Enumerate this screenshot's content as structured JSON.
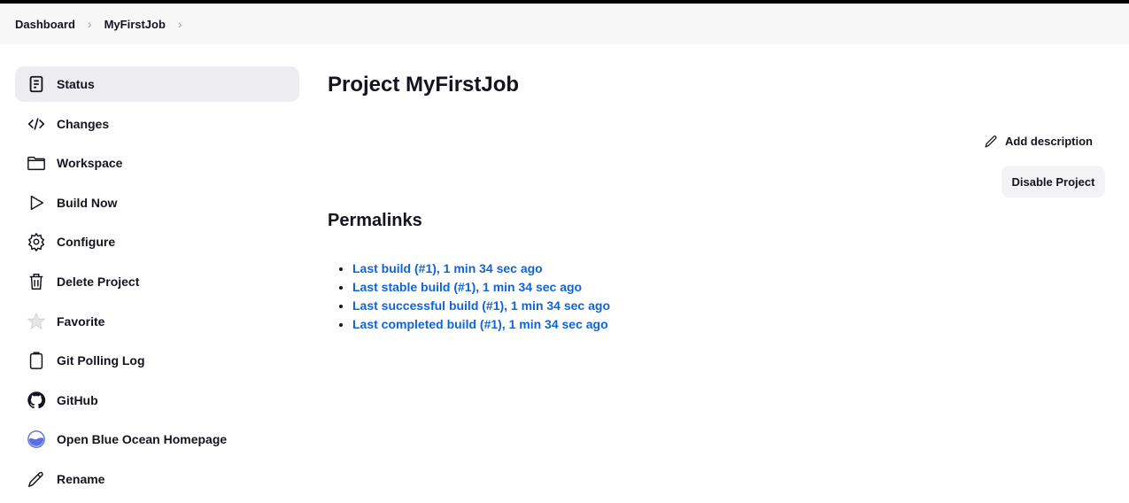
{
  "breadcrumb": [
    "Dashboard",
    "MyFirstJob"
  ],
  "sidebar": {
    "items": [
      {
        "label": "Status",
        "icon": "document-icon"
      },
      {
        "label": "Changes",
        "icon": "code-icon"
      },
      {
        "label": "Workspace",
        "icon": "folder-icon"
      },
      {
        "label": "Build Now",
        "icon": "play-icon"
      },
      {
        "label": "Configure",
        "icon": "gear-icon"
      },
      {
        "label": "Delete Project",
        "icon": "trash-icon"
      },
      {
        "label": "Favorite",
        "icon": "star-icon"
      },
      {
        "label": "Git Polling Log",
        "icon": "clipboard-icon"
      },
      {
        "label": "GitHub",
        "icon": "github-icon"
      },
      {
        "label": "Open Blue Ocean Homepage",
        "icon": "blue-ocean-icon"
      },
      {
        "label": "Rename",
        "icon": "pencil-icon"
      }
    ]
  },
  "main": {
    "title": "Project MyFirstJob",
    "add_description": "Add description",
    "disable_project": "Disable Project",
    "permalinks_heading": "Permalinks",
    "permalinks": [
      "Last build (#1), 1 min 34 sec ago",
      "Last stable build (#1), 1 min 34 sec ago",
      "Last successful build (#1), 1 min 34 sec ago",
      "Last completed build (#1), 1 min 34 sec ago"
    ]
  },
  "colors": {
    "link": "#1164d3",
    "active_bg": "#ececf1",
    "blue_ocean": "#5b6fe0"
  }
}
